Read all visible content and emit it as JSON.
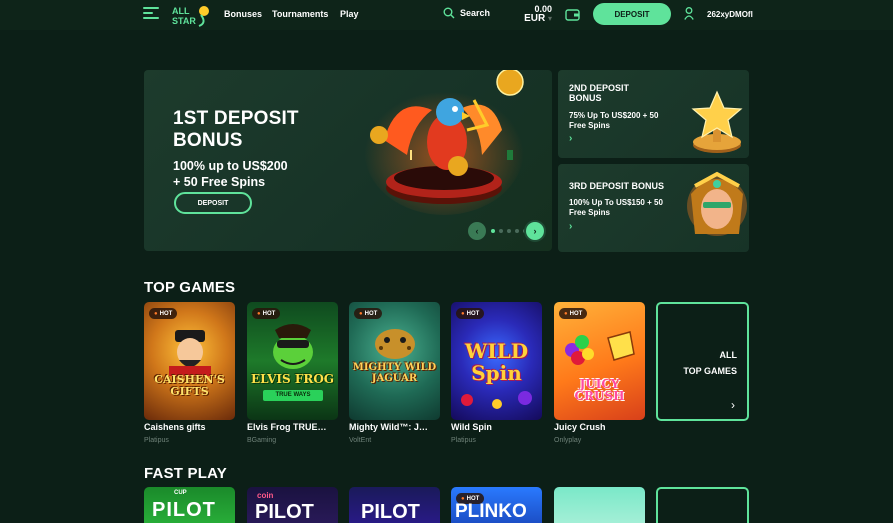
{
  "header": {
    "logo_text": "ALL STAR",
    "nav": [
      "Bonuses",
      "Tournaments",
      "Play"
    ],
    "search_label": "Search",
    "balance_amount": "0.00",
    "balance_currency": "EUR",
    "deposit_label": "DEPOSIT",
    "username": "262xyDMOfl"
  },
  "hero": {
    "title_line1": "1ST DEPOSIT",
    "title_line2": "BONUS",
    "sub_line1": "100% up to US$200",
    "sub_line2": "+ 50 Free Spins",
    "button_label": "DEPOSIT",
    "slides_count": 5,
    "active_slide": 1
  },
  "promos": [
    {
      "title_line1": "2ND DEPOSIT",
      "title_line2": "BONUS",
      "desc_line1": "75% Up To US$200 + 50",
      "desc_line2": "Free Spins",
      "arrow": "›"
    },
    {
      "title_line1": "3RD DEPOSIT BONUS",
      "title_line2": "",
      "desc_line1": "100% Up To US$150 + 50",
      "desc_line2": "Free Spins",
      "arrow": "›"
    }
  ],
  "top_games": {
    "title": "TOP GAMES",
    "hot_label": "HOT",
    "items": [
      {
        "name": "Caishens gifts",
        "provider": "Platipus",
        "art_text": "CAISHEN'S GIFTS"
      },
      {
        "name": "Elvis Frog TRUE…",
        "provider": "BGaming",
        "art_text": "ELVIS FROG"
      },
      {
        "name": "Mighty Wild™: J…",
        "provider": "VoltEnt",
        "art_text": "MIGHTY WILD JAGUAR"
      },
      {
        "name": "Wild Spin",
        "provider": "Platipus",
        "art_text": "WILD Spin"
      },
      {
        "name": "Juicy Crush",
        "provider": "Onlyplay",
        "art_text": "JUICY CRUSH"
      }
    ],
    "all_line1": "ALL",
    "all_line2": "TOP GAMES",
    "all_arrow": "›"
  },
  "fast_play": {
    "title": "FAST PLAY",
    "hot_label": "HOT",
    "items": [
      {
        "art_text": "PILOT"
      },
      {
        "art_text": "PILOT"
      },
      {
        "art_text": "PILOT"
      },
      {
        "art_text": "PLINKO"
      },
      {
        "art_text": ""
      }
    ]
  }
}
